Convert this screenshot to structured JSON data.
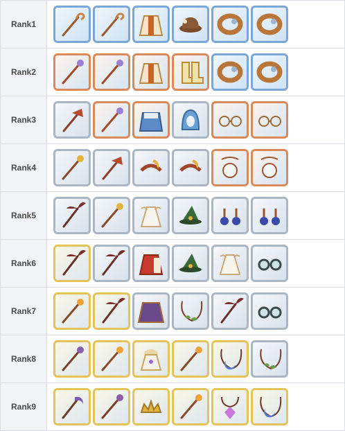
{
  "rows": [
    {
      "label": "Rank1",
      "items": [
        {
          "icon": "staff-icon",
          "frame": "blue"
        },
        {
          "icon": "staff-icon",
          "frame": "blue"
        },
        {
          "icon": "robe-icon",
          "frame": "blue"
        },
        {
          "icon": "hat-icon",
          "frame": "blue"
        },
        {
          "icon": "bracelet-icon",
          "frame": "blue"
        },
        {
          "icon": "bracelet-icon",
          "frame": "blue"
        }
      ]
    },
    {
      "label": "Rank2",
      "items": [
        {
          "icon": "wand-icon",
          "frame": "copper"
        },
        {
          "icon": "wand-icon",
          "frame": "copper"
        },
        {
          "icon": "robe-icon",
          "frame": "copper"
        },
        {
          "icon": "boots-icon",
          "frame": "copper"
        },
        {
          "icon": "bracelet-icon",
          "frame": "blue"
        },
        {
          "icon": "bracelet-icon",
          "frame": "blue"
        }
      ]
    },
    {
      "label": "Rank3",
      "items": [
        {
          "icon": "fan-staff-icon",
          "frame": "silver"
        },
        {
          "icon": "wand-icon",
          "frame": "copper"
        },
        {
          "icon": "armor-icon",
          "frame": "copper"
        },
        {
          "icon": "hood-icon",
          "frame": "silver"
        },
        {
          "icon": "glasses-icon",
          "frame": "copper"
        },
        {
          "icon": "glasses-icon",
          "frame": "copper"
        }
      ]
    },
    {
      "label": "Rank4",
      "items": [
        {
          "icon": "sun-staff-icon",
          "frame": "silver"
        },
        {
          "icon": "fan-staff-icon",
          "frame": "silver"
        },
        {
          "icon": "horn-hat-icon",
          "frame": "silver"
        },
        {
          "icon": "horn-hat-icon",
          "frame": "silver"
        },
        {
          "icon": "pendant-icon",
          "frame": "copper"
        },
        {
          "icon": "pendant-icon",
          "frame": "copper"
        }
      ]
    },
    {
      "label": "Rank5",
      "items": [
        {
          "icon": "wing-staff-icon",
          "frame": "silver"
        },
        {
          "icon": "sun-staff-icon",
          "frame": "silver"
        },
        {
          "icon": "dress-icon",
          "frame": "silver"
        },
        {
          "icon": "witch-hat-icon",
          "frame": "silver"
        },
        {
          "icon": "earring-icon",
          "frame": "silver"
        },
        {
          "icon": "earring-icon",
          "frame": "silver"
        }
      ]
    },
    {
      "label": "Rank6",
      "items": [
        {
          "icon": "wing-staff-icon",
          "frame": "gold"
        },
        {
          "icon": "wing-staff-icon",
          "frame": "silver"
        },
        {
          "icon": "red-robe-icon",
          "frame": "silver"
        },
        {
          "icon": "witch-hat-icon",
          "frame": "silver"
        },
        {
          "icon": "dress-icon",
          "frame": "silver"
        },
        {
          "icon": "goggles-icon",
          "frame": "silver"
        }
      ]
    },
    {
      "label": "Rank7",
      "items": [
        {
          "icon": "flame-staff-icon",
          "frame": "gold"
        },
        {
          "icon": "wing-staff-icon",
          "frame": "gold"
        },
        {
          "icon": "cloak-icon",
          "frame": "silver"
        },
        {
          "icon": "laurel-necklace-icon",
          "frame": "silver"
        },
        {
          "icon": "wing-staff-icon",
          "frame": "silver"
        },
        {
          "icon": "goggles-icon",
          "frame": "silver"
        }
      ]
    },
    {
      "label": "Rank8",
      "items": [
        {
          "icon": "star-staff-icon",
          "frame": "gold"
        },
        {
          "icon": "flame-staff-icon",
          "frame": "gold"
        },
        {
          "icon": "gown-icon",
          "frame": "gold"
        },
        {
          "icon": "flame-staff-icon",
          "frame": "gold"
        },
        {
          "icon": "moon-necklace-icon",
          "frame": "gold"
        },
        {
          "icon": "laurel-necklace-icon",
          "frame": "silver"
        }
      ]
    },
    {
      "label": "Rank9",
      "items": [
        {
          "icon": "scythe-staff-icon",
          "frame": "gold"
        },
        {
          "icon": "star-staff-icon",
          "frame": "gold"
        },
        {
          "icon": "tiara-icon",
          "frame": "gold"
        },
        {
          "icon": "flame-staff-icon",
          "frame": "gold"
        },
        {
          "icon": "crystal-necklace-icon",
          "frame": "gold"
        },
        {
          "icon": "moon-necklace-icon",
          "frame": "gold"
        }
      ]
    }
  ]
}
